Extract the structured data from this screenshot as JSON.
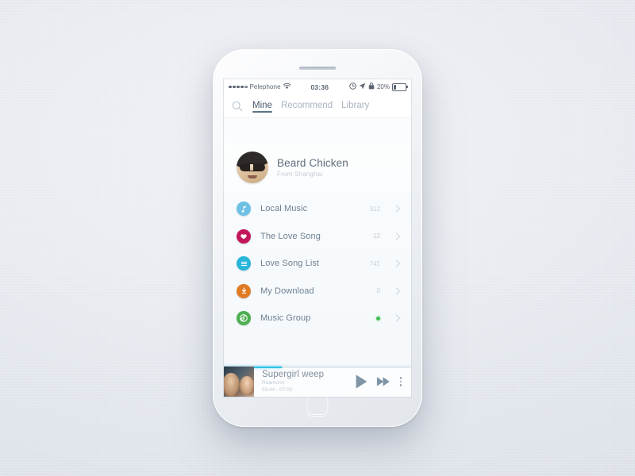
{
  "status_bar": {
    "signal_dots_filled": 4,
    "signal_dots_total": 5,
    "carrier": "Pelephone",
    "wifi_icon": "wifi-icon",
    "time": "03:36",
    "alarm_icon": "alarm-clock-icon",
    "location_icon": "location-arrow-icon",
    "rotation_lock_icon": "rotation-lock-icon",
    "battery_percent": "20%",
    "battery_level": 20
  },
  "navbar": {
    "search_icon": "search-icon",
    "tabs": [
      {
        "label": "Mine",
        "active": true
      },
      {
        "label": "Recommend",
        "active": false
      },
      {
        "label": "Library",
        "active": false
      }
    ]
  },
  "profile": {
    "avatar_icon": "user-avatar",
    "name": "Beard Chicken",
    "subtitle": "From Shanghai"
  },
  "list": {
    "items": [
      {
        "label": "Local Music",
        "count": "312",
        "icon": "music-note-icon",
        "color": "#6ec1e4",
        "badge": false
      },
      {
        "label": "The Love Song",
        "count": "12",
        "icon": "heart-icon",
        "color": "#c2185b",
        "badge": false
      },
      {
        "label": "Love Song List",
        "count": "741",
        "icon": "playlist-icon",
        "color": "#29b6d8",
        "badge": false
      },
      {
        "label": "My Download",
        "count": "0",
        "icon": "download-icon",
        "color": "#e07b24",
        "badge": false
      },
      {
        "label": "Music Group",
        "count": "",
        "icon": "music-group-icon",
        "color": "#4caf50",
        "badge": true
      }
    ],
    "chevron_icon": "chevron-right-icon"
  },
  "player": {
    "album_art_icon": "album-artwork",
    "title": "Supergirl weep",
    "artist": "Reamonn",
    "time": "03:44 - 07:00",
    "progress_percent": 31,
    "progress_color": "#2ec4e8",
    "play_icon": "play-icon",
    "next_icon": "next-track-icon",
    "menu_icon": "more-vertical-icon"
  },
  "device": {
    "speaker_icon": "earpiece-speaker",
    "home_button_icon": "home-button"
  }
}
